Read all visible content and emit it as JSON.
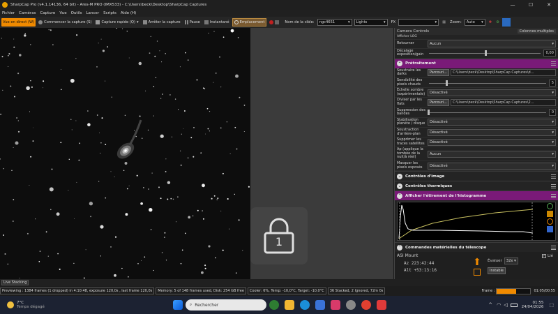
{
  "window": {
    "title": "SharpCap Pro (v4.1.14136, 64 bit) - Ares-M PRO (IMX533) - C:\\Users\\beck\\Desktop\\SharpCap Captures",
    "controls": [
      "—",
      "☐",
      "✕"
    ]
  },
  "menu": [
    "Fichier",
    "Caméras",
    "Capture",
    "Vue",
    "Outils",
    "Lancer",
    "Scripts",
    "Aide (H)"
  ],
  "toolbar": {
    "live": "Vue en direct (W)",
    "start_capture": "Commencer la capture (S)",
    "quick_capture": "Capture rapide (Q)",
    "stop_capture": "Arrêter la capture",
    "pause": "Pause",
    "snapshot": "Instantané",
    "reticle": "Emplacement",
    "target_label": "Nom de la cible:",
    "target_value": "ngc4651",
    "frame_type": "Lights",
    "fx_label": "FX",
    "zoom_label": "Zoom:",
    "zoom_value": "Auto"
  },
  "overlay": {
    "lock_number": "1"
  },
  "panel": {
    "header": "Camera Controls",
    "toggle_label": "Colonnes multiples",
    "top_label": "Afficher LOG",
    "rows_top": [
      {
        "label": "Retourner",
        "value": "Aucun"
      },
      {
        "label": "Décalage exposition/gain",
        "value": "0,00",
        "slider": 0.5
      }
    ],
    "sections": {
      "pretraitement": "Prétraitement",
      "controles_image": "Contrôles d'image",
      "controles_thermiques": "Contrôles thermiques",
      "histogramme": "Afficher l'étirement de l'histogramme",
      "telescope": "Commandes matérielles du télescope"
    },
    "pre": [
      {
        "label": "Soustraire les darks",
        "browse": "Parcouri...",
        "path": "C:\\Users\\beck\\Desktop\\SharpCap Captures\\d..."
      },
      {
        "label": "Sensibilité des pixels chauds",
        "value": "5",
        "slider": 0.15
      },
      {
        "label": "Échelle sombre (expérimentale)",
        "value": "Désactivé"
      },
      {
        "label": "Diviser par les flats",
        "browse": "Parcouri...",
        "path": "C:\\Users\\beck\\Desktop\\SharpCap Captures\\2..."
      },
      {
        "label": "Suppression des bandes",
        "value": "0",
        "slider": 0.0
      },
      {
        "label": "Stabilisation planète / disque",
        "value": "Désactivé"
      },
      {
        "label": "Soustraction d'arrière-plan",
        "value": "Désactivé"
      },
      {
        "label": "Supprimer les traces satellites",
        "value": "Désactivé"
      },
      {
        "label": "Ap (applique la tombée de la nuit/à réel)",
        "value": "Aucun"
      },
      {
        "label": "Masquer les pixels exposés",
        "value": "Désactivé"
      }
    ],
    "telescope": {
      "mount": "ASI Mount",
      "az_label": "Az",
      "az": "223:42:44",
      "alt_label": "Alt",
      "alt": "+53:13:16",
      "evaluate_label": "Évaluer",
      "rate": "32x",
      "speed_btn": "Instable",
      "list_label": "Lié"
    }
  },
  "status": {
    "live_stacking": "Live Stacking",
    "preview": "Previewing : 1384 frames (1 dropped) in 4:10:48, exposure 120,0s , last frame 120,0s",
    "memory": "Memory: 5 of 148 frames used, Disk: 254 GB free",
    "cooler": "Cooler: 6%, Temp: -10,0°C, Target: -10,0°C",
    "stack": "36 Stacked, 2 Ignored, 72m 0s",
    "frame_label": "Frame :",
    "frame_progress": 0.58,
    "time": "01:05/00:55"
  },
  "taskbar": {
    "weather_temp": "7°C",
    "weather_desc": "Temps dégagé",
    "search": "Rechercher",
    "clock_time": "01:55",
    "clock_date": "24/04/2026"
  },
  "colors": {
    "accent": "#f08a00",
    "section_highlight": "#7a1a78",
    "histogram_curve": "#ffffff",
    "histogram_stretch": "#c8c060"
  }
}
